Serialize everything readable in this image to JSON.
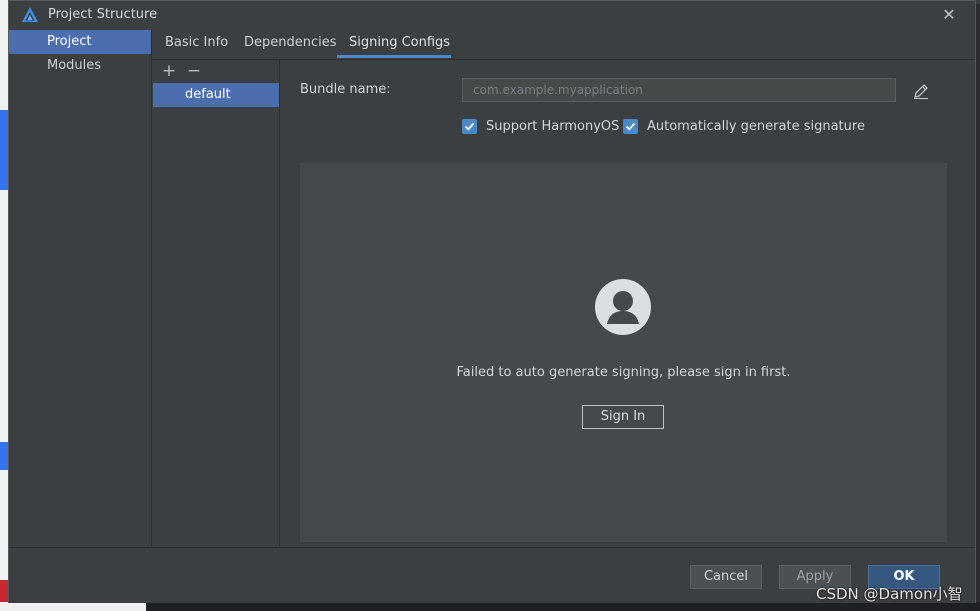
{
  "window": {
    "title": "Project Structure",
    "close_glyph": "✕"
  },
  "nav": {
    "items": [
      {
        "label": "Project",
        "selected": true
      },
      {
        "label": "Modules",
        "selected": false
      }
    ]
  },
  "tabs": [
    {
      "label": "Basic Info",
      "active": false
    },
    {
      "label": "Dependencies",
      "active": false
    },
    {
      "label": "Signing Configs",
      "active": true
    }
  ],
  "configs": {
    "add_glyph": "+",
    "remove_glyph": "−",
    "items": [
      {
        "label": "default",
        "selected": true
      }
    ]
  },
  "bundle": {
    "label": "Bundle name:",
    "value": "",
    "placeholder": "com.example.myapplication"
  },
  "checkboxes": {
    "support_harmonyos": {
      "label": "Support HarmonyOS",
      "checked": true
    },
    "auto_signature": {
      "label": "Automatically generate signature",
      "checked": true
    }
  },
  "signin": {
    "message": "Failed to auto generate signing, please sign in first.",
    "button_label": "Sign In"
  },
  "footer": {
    "cancel_label": "Cancel",
    "apply_label": "Apply",
    "ok_label": "OK"
  },
  "watermark": "CSDN @Damon小智",
  "colors": {
    "accent": "#4a88c7",
    "selection": "#4b6eaf",
    "ok_button": "#365880",
    "dialog_bg": "#3c3f41"
  },
  "icons": {
    "app": "harmony-logo-icon",
    "close": "close-icon",
    "edit": "pencil-icon",
    "avatar": "user-avatar-icon",
    "check": "checkmark-icon"
  }
}
